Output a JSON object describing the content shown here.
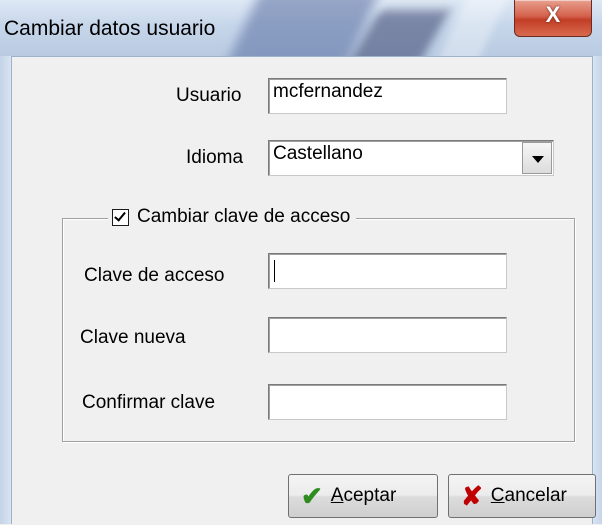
{
  "window": {
    "title": "Cambiar datos usuario",
    "close_glyph": "X"
  },
  "form": {
    "usuario_label": "Usuario",
    "usuario_value": "mcfernandez",
    "idioma_label": "Idioma",
    "idioma_value": "Castellano"
  },
  "group": {
    "checkbox_label": "Cambiar clave de acceso",
    "checked": true,
    "clave_acceso_label": "Clave de acceso",
    "clave_nueva_label": "Clave nueva",
    "confirmar_label": "Confirmar clave",
    "clave_acceso_value": "",
    "clave_nueva_value": "",
    "confirmar_value": ""
  },
  "buttons": {
    "aceptar_first": "A",
    "aceptar_rest": "ceptar",
    "cancelar_first": "C",
    "cancelar_rest": "ancelar",
    "aceptar_icon": "check-icon",
    "cancelar_icon": "cross-icon",
    "aceptar_icon_color": "#2e8b1e",
    "cancelar_icon_color": "#c00000"
  }
}
